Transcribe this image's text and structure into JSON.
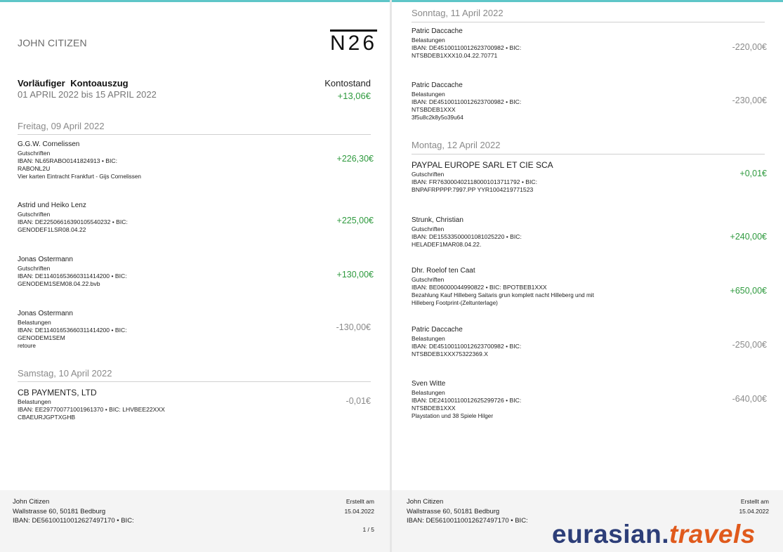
{
  "header": {
    "account_holder": "JOHN CITIZEN",
    "logo_text": "N26",
    "doc_title": "Vorläufiger Kontoauszug",
    "period": "01 APRIL 2022 bis 15 APRIL 2022",
    "balance_label": "Kontostand",
    "balance": "+13,06€"
  },
  "days": {
    "fri": "Freitag, 09 April 2022",
    "sat": "Samstag, 10 April 2022",
    "sun": "Sonntag, 11 April 2022",
    "mon": "Montag, 12 April 2022"
  },
  "transactions": [
    {
      "name": "G.G.W. Cornelissen",
      "type": "Gutschriften",
      "iban": "IBAN: NL65RABO0141824913 • BIC:",
      "bic": "RABONL2U",
      "ref": "Vier karten Eintracht Frankfurt - Gijs Cornelissen",
      "amount": "+226,30€"
    },
    {
      "name": "Astrid und Heiko Lenz",
      "type": "Gutschriften",
      "iban": "IBAN: DE22506616390105540232 • BIC:",
      "bic": "GENODEF1LSR08.04.22",
      "ref": "",
      "amount": "+225,00€"
    },
    {
      "name": "Jonas Ostermann",
      "type": "Gutschriften",
      "iban": "IBAN: DE11401653660311414200 • BIC:",
      "bic": "GENODEM1SEM08.04.22.bvb",
      "ref": "",
      "amount": "+130,00€"
    },
    {
      "name": "Jonas Ostermann",
      "type": "Belastungen",
      "iban": "IBAN: DE11401653660311414200 • BIC:",
      "bic": "GENODEM1SEM",
      "ref": "retoure",
      "amount": "-130,00€"
    },
    {
      "name": "CB PAYMENTS, LTD",
      "type": "Belastungen",
      "iban": "IBAN: EE297700771001961370 • BIC: LHVBEE22XXX",
      "bic": "CBAEURJGPTXGHB",
      "ref": "",
      "amount": "-0,01€"
    },
    {
      "name": "Patric Daccache",
      "type": "Belastungen",
      "iban": "IBAN: DE45100110012623700982 • BIC:",
      "bic": "NTSBDEB1XXX10.04.22.70771",
      "ref": "",
      "amount": "-220,00€"
    },
    {
      "name": "Patric Daccache",
      "type": "Belastungen",
      "iban": "IBAN: DE45100110012623700982 • BIC:",
      "bic": "NTSBDEB1XXX",
      "ref": "3f5u8c2k8y5o39u64",
      "amount": "-230,00€"
    },
    {
      "name": "PAYPAL EUROPE SARL ET CIE SCA",
      "type": "Gutschriften",
      "iban": "IBAN: FR7630004021180001013711792 • BIC:",
      "bic": "BNPAFRPPPP.7997.PP YYR1004219771523",
      "ref": "",
      "amount": "+0,01€"
    },
    {
      "name": "Strunk, Christian",
      "type": "Gutschriften",
      "iban": "IBAN: DE15533500001081025220 • BIC:",
      "bic": "HELADEF1MAR08.04.22.",
      "ref": "",
      "amount": "+240,00€"
    },
    {
      "name": "Dhr. Roelof ten Caat",
      "type": "Gutschriften",
      "iban": "IBAN: BE06000044990822 • BIC: BPOTBEB1XXX",
      "bic": "Bezahlung Kauf Hilleberg Saitaris grun komplett nacht Hilleberg und mit",
      "ref": "Hilleberg Footprint-(Zeltunterlage)",
      "amount": "+650,00€"
    },
    {
      "name": "Patric Daccache",
      "type": "Belastungen",
      "iban": "IBAN: DE45100110012623700982 • BIC:",
      "bic": "NTSBDEB1XXX75322369.X",
      "ref": "",
      "amount": "-250,00€"
    },
    {
      "name": "Sven Witte",
      "type": "Belastungen",
      "iban": "IBAN: DE24100110012625299726 • BIC:",
      "bic": "NTSBDEB1XXX",
      "ref": "Playstation und 38 Spiele Hilger",
      "amount": "-640,00€"
    }
  ],
  "footer": {
    "name": "John Citizen",
    "address": "Wallstrasse 60, 50181 Bedburg",
    "iban": "IBAN:  DE56100110012627497170  •  BIC:",
    "created_label": "Erstellt am",
    "created_date": "15.04.2022",
    "page": "1 / 5"
  },
  "watermark": {
    "brand": "eurasian.",
    "accent": "travels"
  }
}
